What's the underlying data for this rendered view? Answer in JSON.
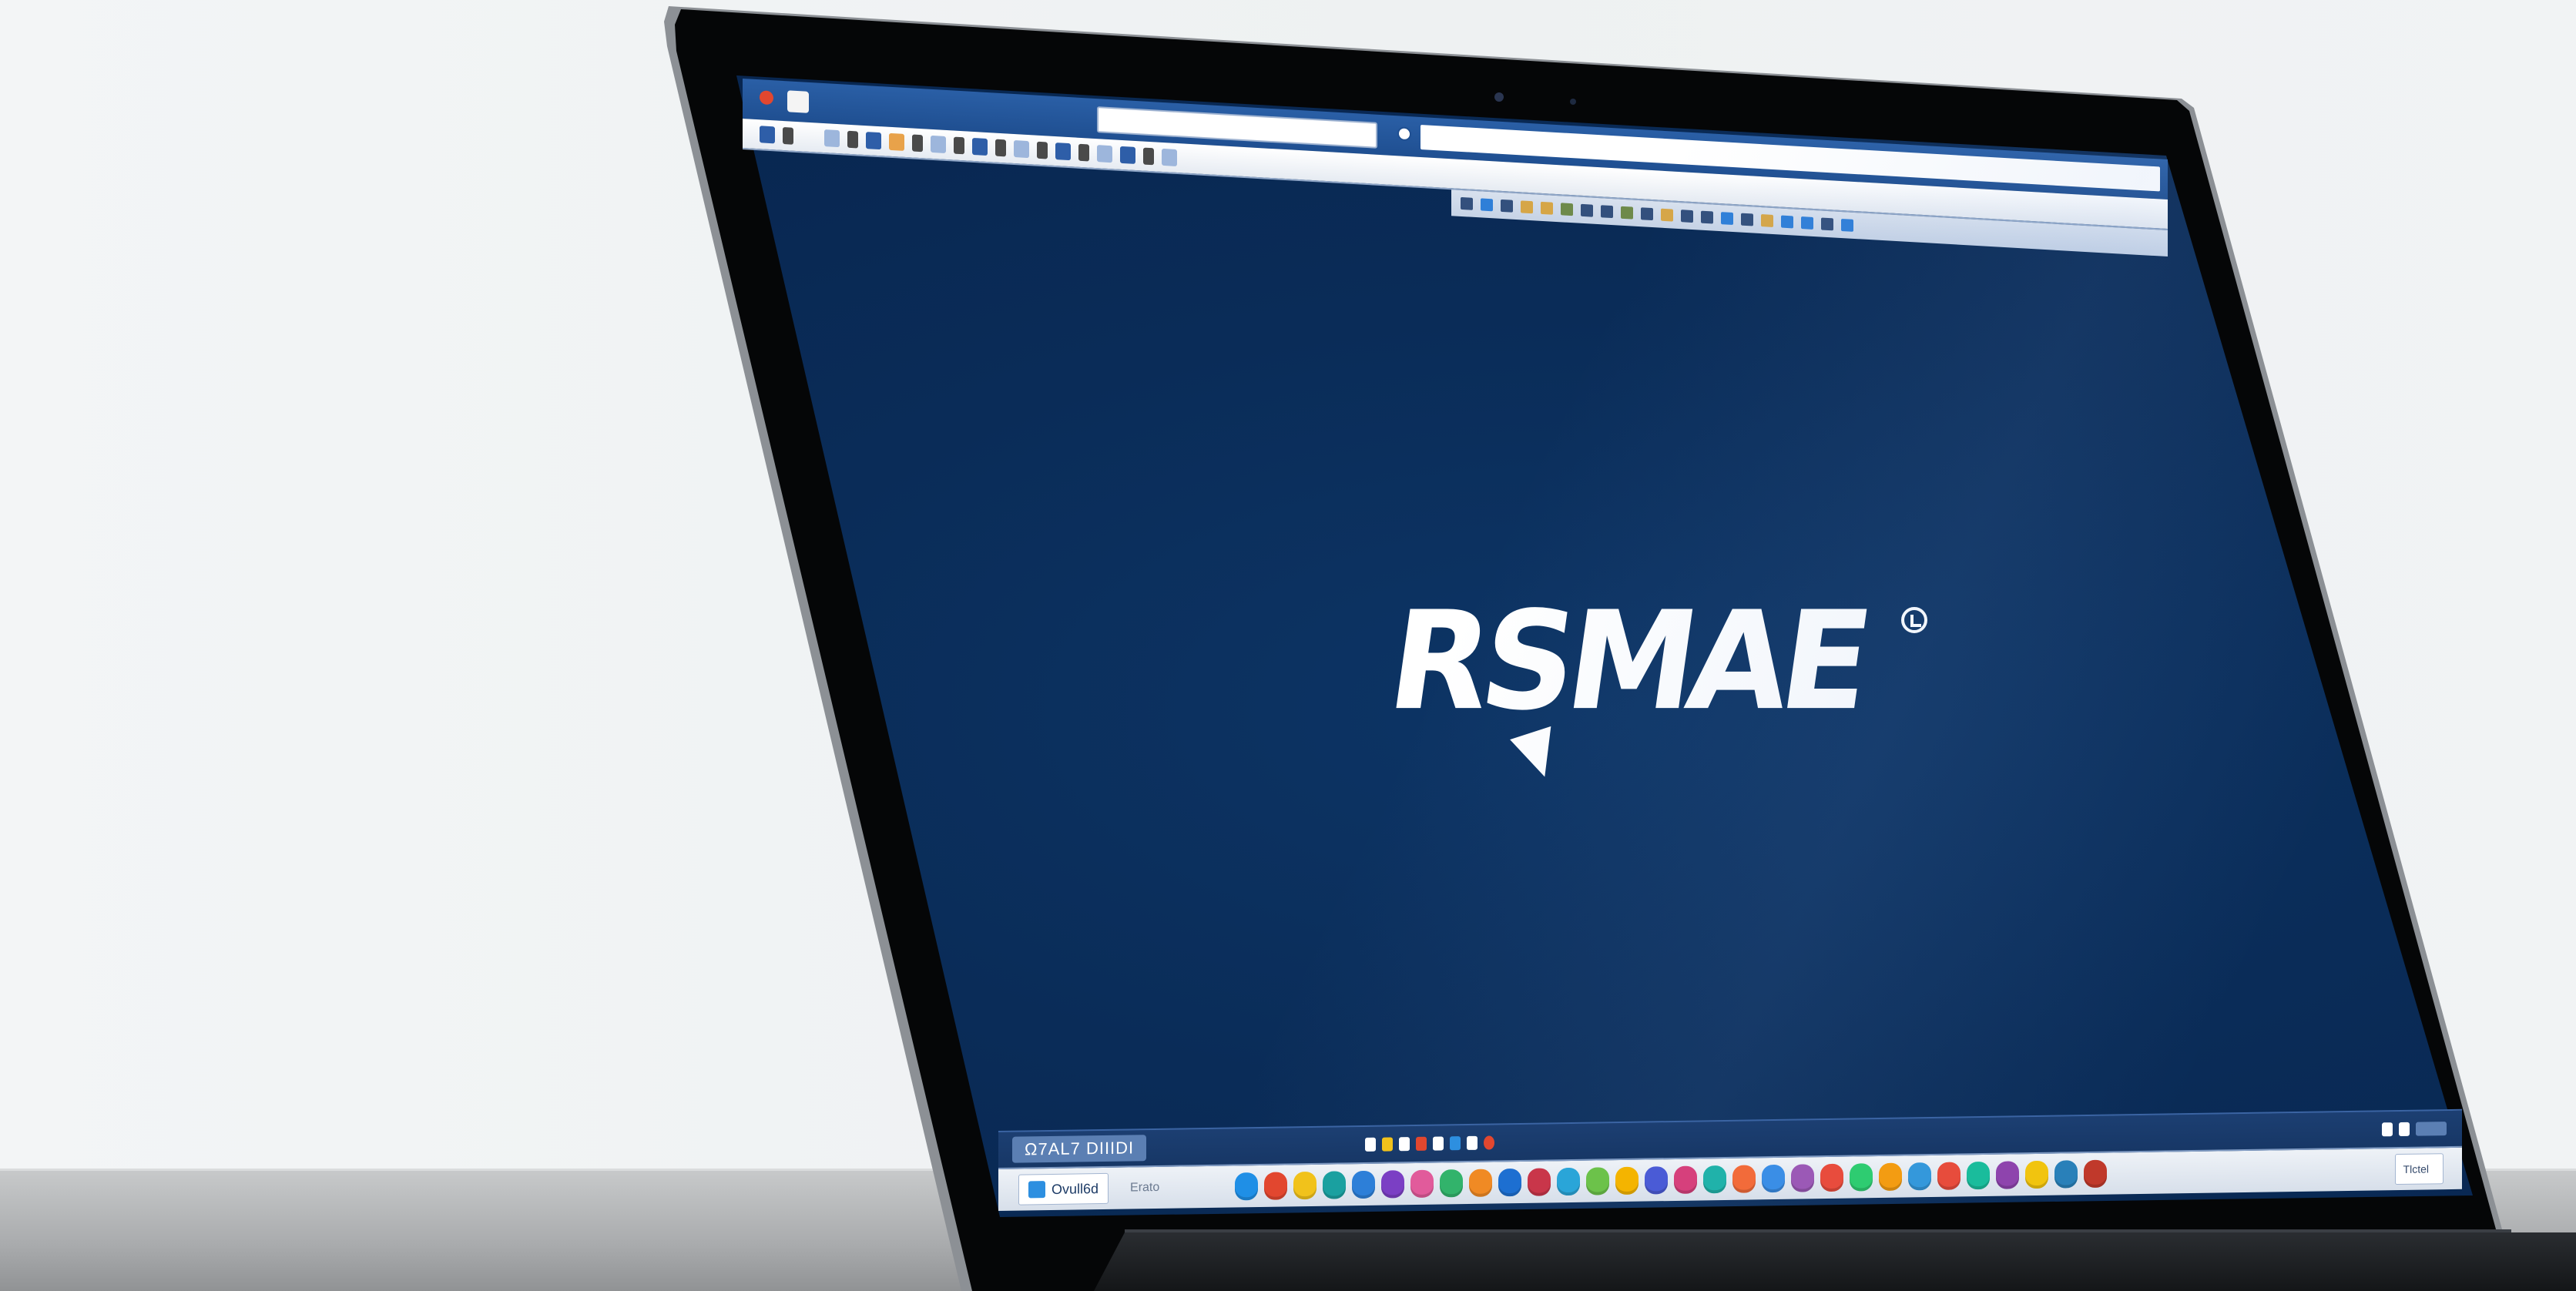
{
  "app": {
    "window_title": "",
    "logo_text": "RSMAE",
    "logo_mark": "registered-mark"
  },
  "toolbar": {
    "icons": [
      "file-icon",
      "edit-icon",
      "view-icon",
      "format-icon",
      "tools-icon",
      "window-icon",
      "help-icon",
      "zoom-icon"
    ]
  },
  "taskbar": {
    "tab_label": "Ω7AL7 DIIIDI",
    "start_label": "Ovull6d",
    "search_placeholder": "Erato",
    "tray_text": "Tlctel",
    "clock": "",
    "dock_colors": [
      "#1f8fe6",
      "#e2472f",
      "#f1c21b",
      "#1aa0a0",
      "#2d7fd8",
      "#7b3fc4",
      "#e15b9b",
      "#32b36b",
      "#f08a24",
      "#1d6fd1",
      "#c9364a",
      "#2aa5d8",
      "#6cc24a",
      "#f4b400",
      "#4a5bd6",
      "#d6407c",
      "#20b2aa",
      "#f26b3a",
      "#3a8ee6",
      "#9b59b6",
      "#e84c3d",
      "#2ecc71",
      "#f39c12",
      "#3498db",
      "#e74c3c",
      "#1abc9c",
      "#8e44ad",
      "#f1c40f",
      "#2980b9",
      "#c0392b"
    ]
  },
  "colors": {
    "screen_bg": "#082650",
    "titlebar": "#1f4f91",
    "accent": "#2d8fe0"
  }
}
